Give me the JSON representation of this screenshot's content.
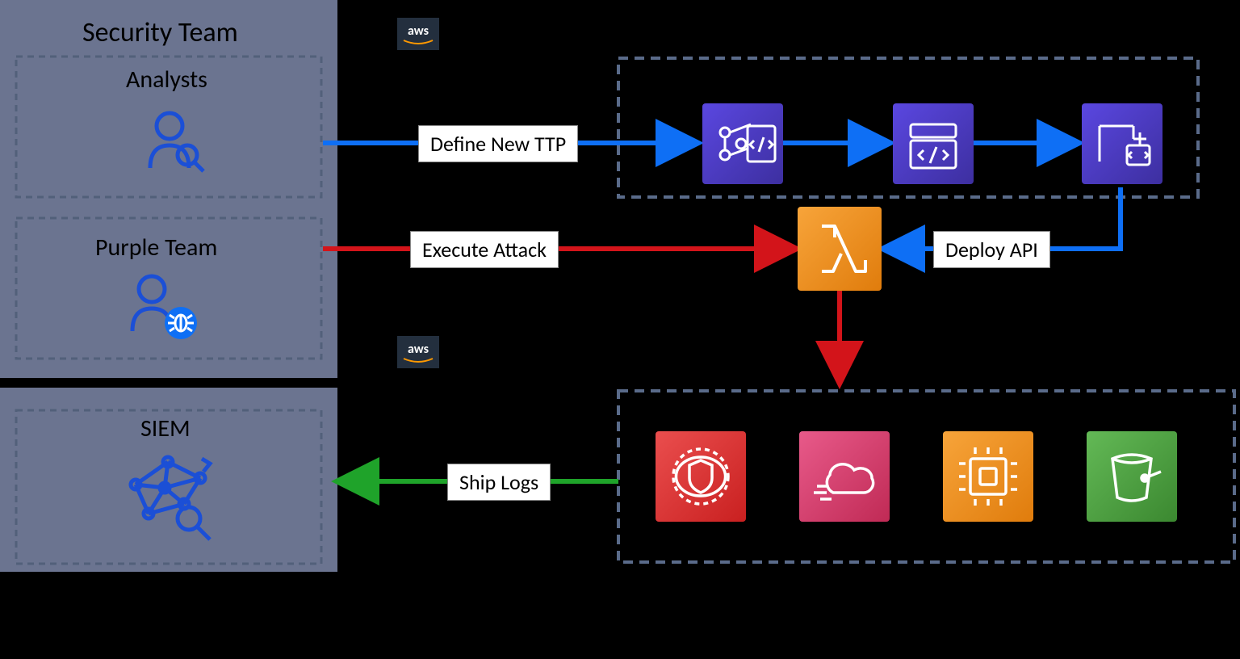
{
  "panel": {
    "security_team_title": "Security Team",
    "analysts_title": "Analysts",
    "purple_team_title": "Purple Team",
    "siem_title": "SIEM"
  },
  "labels": {
    "define_ttp": "Define New TTP",
    "execute_attack": "Execute Attack",
    "deploy_api": "Deploy API",
    "ship_logs": "Ship Logs"
  },
  "aws_badge": "aws",
  "icons": {
    "analyst": "analyst-icon",
    "purple_team": "purple-team-icon",
    "siem": "siem-icon",
    "aws_logo_top": "aws-logo-icon",
    "aws_logo_mid": "aws-logo-icon",
    "codecommit": "aws-codecommit-icon",
    "codebuild": "aws-codebuild-icon",
    "codepipeline": "aws-codepipeline-icon",
    "lambda": "aws-lambda-icon",
    "security_hub": "aws-security-hub-icon",
    "cloudtrail": "aws-cloudtrail-icon",
    "ec2": "aws-ec2-icon",
    "s3": "aws-s3-icon"
  },
  "colors": {
    "panel_bg": "#6b7490",
    "panel_border": "#52607a",
    "blue_arrow": "#0e6ff5",
    "red_arrow": "#d3141a",
    "green_arrow": "#1fa32a",
    "aws_purple": "#4b39c3",
    "aws_orange": "#ed8b1f",
    "aws_red": "#dd3435",
    "aws_pink": "#d53c6c",
    "aws_ec2_orange": "#ed8b1f",
    "aws_green": "#4a9c3e"
  }
}
